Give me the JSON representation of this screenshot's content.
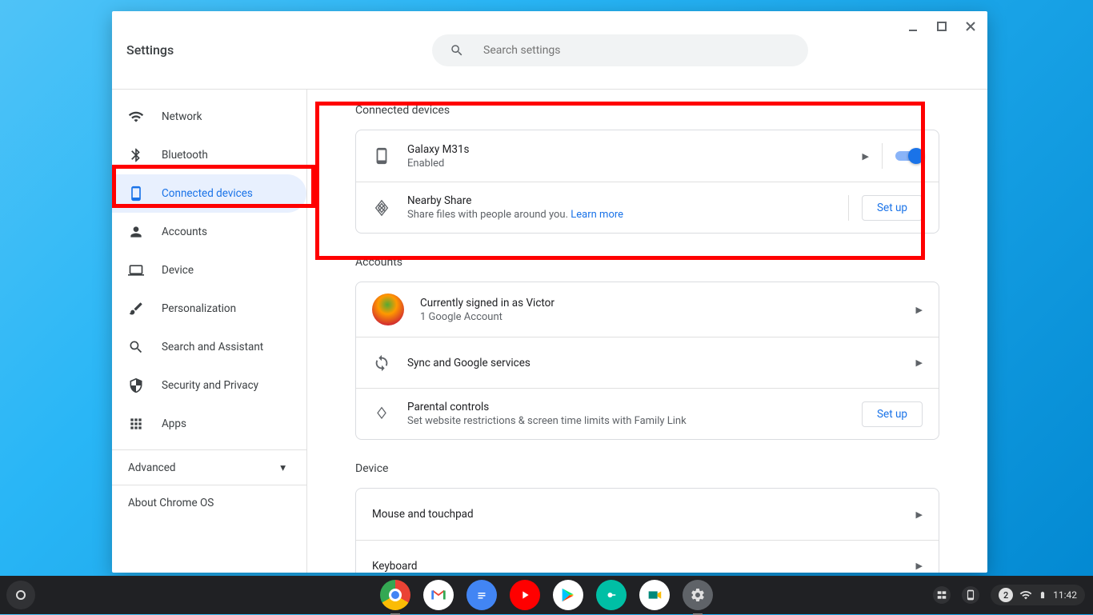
{
  "window": {
    "title": "Settings",
    "search_placeholder": "Search settings"
  },
  "sidebar": {
    "items": [
      {
        "label": "Network"
      },
      {
        "label": "Bluetooth"
      },
      {
        "label": "Connected devices"
      },
      {
        "label": "Accounts"
      },
      {
        "label": "Device"
      },
      {
        "label": "Personalization"
      },
      {
        "label": "Search and Assistant"
      },
      {
        "label": "Security and Privacy"
      },
      {
        "label": "Apps"
      }
    ],
    "advanced": "Advanced",
    "about": "About Chrome OS"
  },
  "sections": {
    "connected": {
      "title": "Connected devices",
      "phone": {
        "name": "Galaxy M31s",
        "status": "Enabled",
        "toggled": true
      },
      "nearby": {
        "title": "Nearby Share",
        "subtitle": "Share files with people around you. ",
        "link": "Learn more",
        "button": "Set up"
      }
    },
    "accounts": {
      "title": "Accounts",
      "signed_in": {
        "title": "Currently signed in as Victor",
        "subtitle": "1 Google Account"
      },
      "sync": {
        "title": "Sync and Google services"
      },
      "parental": {
        "title": "Parental controls",
        "subtitle": "Set website restrictions & screen time limits with Family Link",
        "button": "Set up"
      }
    },
    "device": {
      "title": "Device",
      "rows": [
        {
          "title": "Mouse and touchpad"
        },
        {
          "title": "Keyboard"
        }
      ]
    }
  },
  "shelf": {
    "notification_count": "2",
    "time": "11:42"
  }
}
